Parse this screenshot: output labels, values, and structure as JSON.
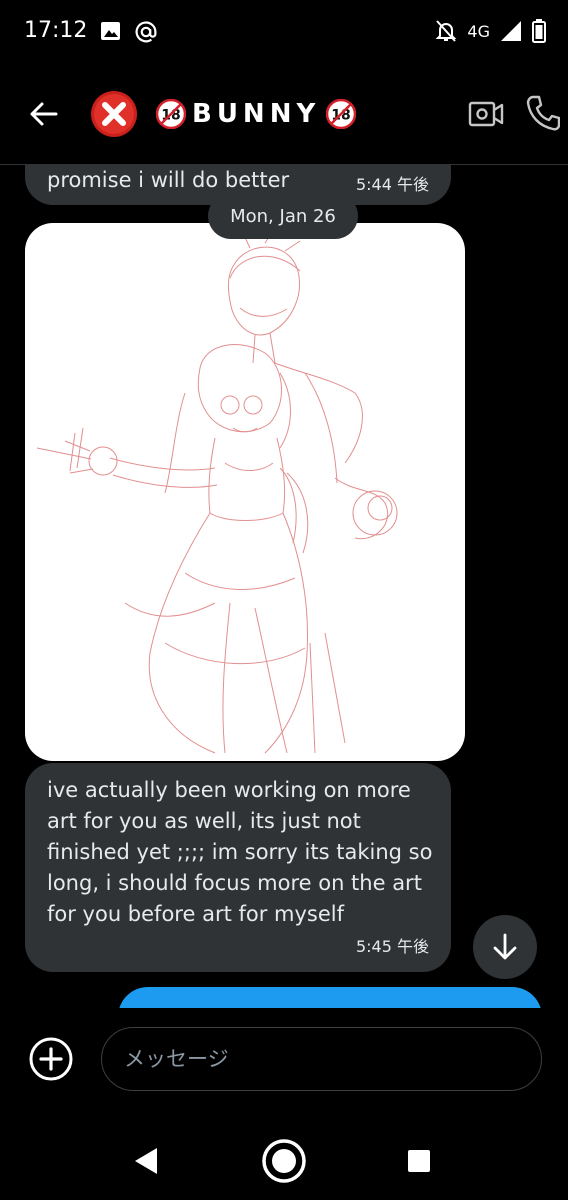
{
  "status_bar": {
    "time": "17:12",
    "network": "4G"
  },
  "header": {
    "title": "BUNNY",
    "badge_text": "18"
  },
  "messages": [
    {
      "direction": "incoming",
      "text": "promise i will do better",
      "time": "5:44 午後"
    },
    {
      "type": "date_separator",
      "text": "Mon, Jan 26"
    },
    {
      "direction": "incoming",
      "type": "image",
      "description_icon": "sketch-drawing"
    },
    {
      "direction": "incoming",
      "text": "ive actually been working on more art for you as well, its just not finished yet ;;;; im sorry its taking so long, i should focus more on the art for you before art for myself",
      "time": "5:45 午後"
    }
  ],
  "composer": {
    "placeholder": "メッセージ"
  },
  "colors": {
    "background": "#000000",
    "incoming_bubble": "#2f3336",
    "outgoing_bubble": "#1d9bf0",
    "text": "#e7e9ea",
    "avatar_red": "#e0302a"
  },
  "icons": [
    "image-icon",
    "at-icon",
    "bell-off-icon",
    "signal-icon",
    "battery-icon",
    "back-arrow-icon",
    "red-x-avatar-icon",
    "video-call-icon",
    "phone-icon",
    "arrow-down-icon",
    "add-circle-icon",
    "nav-back-icon",
    "nav-home-icon",
    "nav-recents-icon"
  ]
}
